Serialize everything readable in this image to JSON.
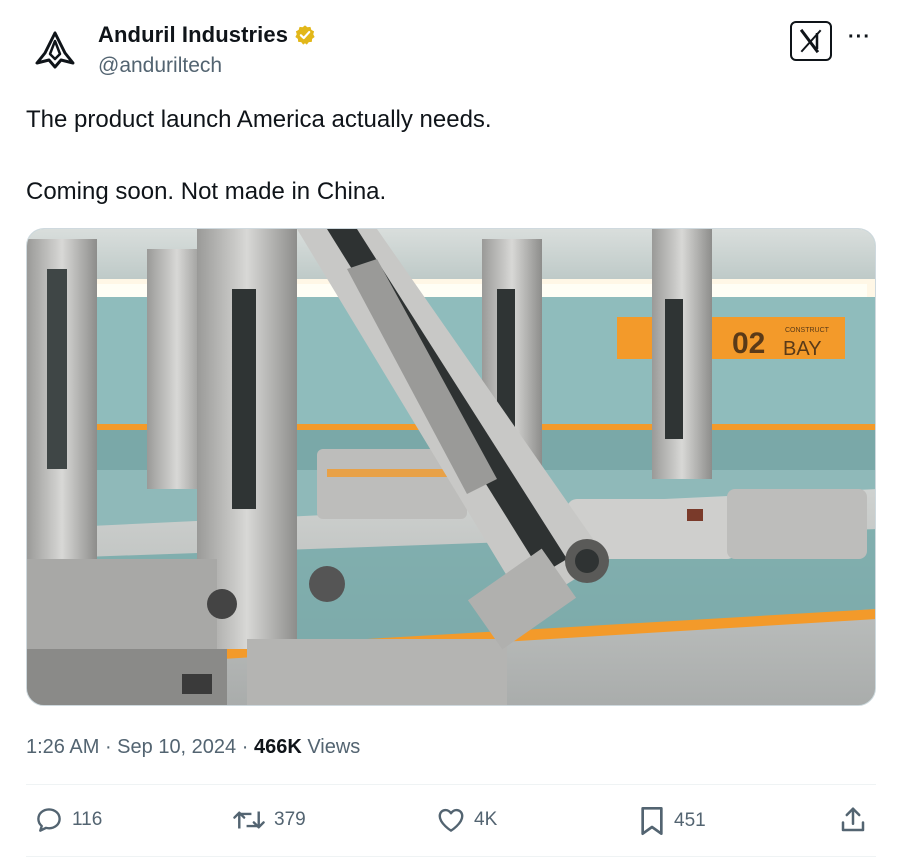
{
  "author": {
    "name": "Anduril Industries",
    "handle": "@anduriltech",
    "verified_color": "#e2b719"
  },
  "tweet": {
    "lines": [
      "The product launch America actually needs.",
      "Coming soon. Not made in China."
    ]
  },
  "media": {
    "bay_sign_number": "02",
    "bay_sign_word": "BAY",
    "bay_sign_small": "CONSTRUCT",
    "accent_color": "#f39a2a",
    "wall_color": "#8fb9b9"
  },
  "meta": {
    "time": "1:26 AM",
    "sep1": " · ",
    "date": "Sep 10, 2024",
    "sep2": " · ",
    "views_count": "466K",
    "views_label": " Views"
  },
  "actions": {
    "replies": "116",
    "reposts": "379",
    "likes": "4K",
    "bookmarks": "451"
  },
  "icons": [
    "anduril-logo-icon",
    "verified-badge-icon",
    "x-logo-icon",
    "more-icon",
    "reply-icon",
    "repost-icon",
    "like-icon",
    "bookmark-icon",
    "share-icon"
  ]
}
